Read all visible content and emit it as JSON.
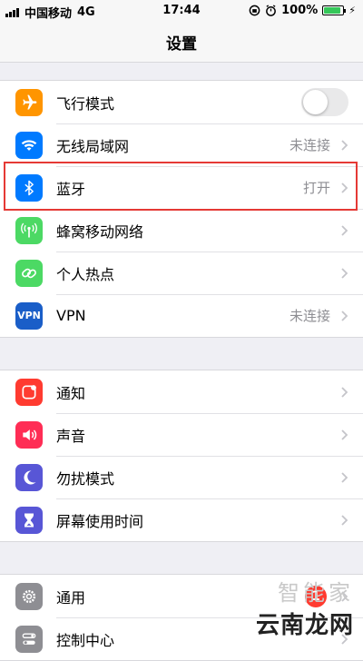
{
  "status_bar": {
    "carrier": "中国移动",
    "network": "4G",
    "time": "17:44",
    "battery": "100%"
  },
  "nav": {
    "title": "设置"
  },
  "group1": [
    {
      "label": "飞行模式",
      "icon": "airplane-icon",
      "color": "#ff9500",
      "type": "toggle",
      "toggle_on": false
    },
    {
      "label": "无线局域网",
      "icon": "wifi-icon",
      "color": "#007aff",
      "value": "未连接"
    },
    {
      "label": "蓝牙",
      "icon": "bluetooth-icon",
      "color": "#007aff",
      "value": "打开"
    },
    {
      "label": "蜂窝移动网络",
      "icon": "cellular-icon",
      "color": "#4cd964"
    },
    {
      "label": "个人热点",
      "icon": "hotspot-icon",
      "color": "#4cd964"
    },
    {
      "label": "VPN",
      "icon": "vpn-icon",
      "icon_text": "VPN",
      "color": "#1a5ec8",
      "value": "未连接"
    }
  ],
  "group2": [
    {
      "label": "通知",
      "icon": "notification-icon",
      "color": "#ff3b30"
    },
    {
      "label": "声音",
      "icon": "sound-icon",
      "color": "#ff2d55"
    },
    {
      "label": "勿扰模式",
      "icon": "moon-icon",
      "color": "#5856d6"
    },
    {
      "label": "屏幕使用时间",
      "icon": "hourglass-icon",
      "color": "#5856d6"
    }
  ],
  "group3": [
    {
      "label": "通用",
      "icon": "gear-icon",
      "color": "#8e8e93",
      "badge": "1"
    },
    {
      "label": "控制中心",
      "icon": "control-center-icon",
      "color": "#8e8e93"
    }
  ],
  "watermark": {
    "line1": "智能家",
    "line2": "云南龙网"
  }
}
